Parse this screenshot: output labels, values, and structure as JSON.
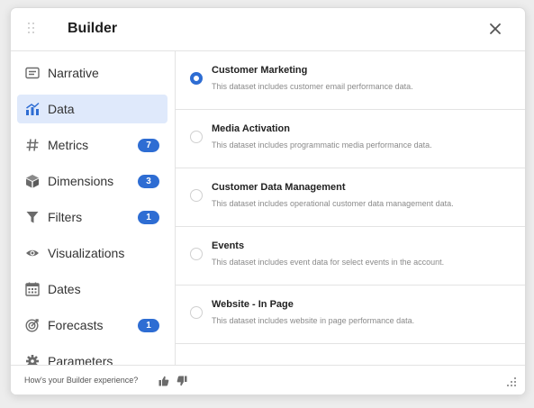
{
  "header": {
    "title": "Builder",
    "drag_icon": "drag-handle-icon",
    "close_icon": "close-icon"
  },
  "sidebar": {
    "items": [
      {
        "label": "Narrative",
        "icon": "narrative-icon",
        "badge": ""
      },
      {
        "label": "Data",
        "icon": "data-chart-icon",
        "badge": "",
        "active": true
      },
      {
        "label": "Metrics",
        "icon": "hash-icon",
        "badge": "7"
      },
      {
        "label": "Dimensions",
        "icon": "cube-icon",
        "badge": "3"
      },
      {
        "label": "Filters",
        "icon": "filter-icon",
        "badge": "1"
      },
      {
        "label": "Visualizations",
        "icon": "eye-icon",
        "badge": ""
      },
      {
        "label": "Dates",
        "icon": "calendar-icon",
        "badge": ""
      },
      {
        "label": "Forecasts",
        "icon": "target-icon",
        "badge": "1"
      },
      {
        "label": "Parameters",
        "icon": "gear-icon",
        "badge": ""
      }
    ]
  },
  "datasets": [
    {
      "title": "Customer Marketing",
      "description": "This dataset includes customer email performance data.",
      "selected": true
    },
    {
      "title": "Media Activation",
      "description": "This dataset includes programmatic media performance data.",
      "selected": false
    },
    {
      "title": "Customer Data Management",
      "description": "This dataset includes operational customer data management data.",
      "selected": false
    },
    {
      "title": "Events",
      "description": "This dataset includes event data for select events in the account.",
      "selected": false
    },
    {
      "title": "Website - In Page",
      "description": "This dataset includes website in page performance data.",
      "selected": false
    }
  ],
  "footer": {
    "feedback_text": "How's your Builder experience?",
    "thumbs_up_icon": "thumbs-up-icon",
    "thumbs_down_icon": "thumbs-down-icon",
    "resize_icon": "resize-handle-icon"
  },
  "colors": {
    "accent": "#2e6dd3",
    "active_bg": "#dfe9fb",
    "icon": "#6b6b6b"
  }
}
